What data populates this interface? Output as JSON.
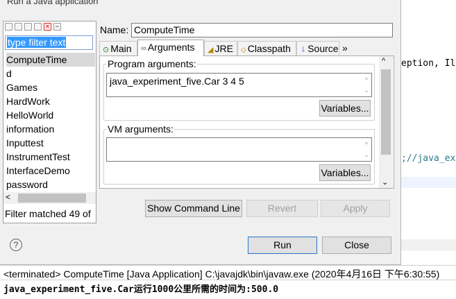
{
  "dialog": {
    "title": "Run a Java application",
    "filter_placeholder": "type filter text",
    "config_list": [
      "ComputeTime",
      "d",
      "Games",
      "HardWork",
      "HelloWorld",
      "information",
      "Inputtest",
      "InstrumentTest",
      "InterfaceDemo",
      "password"
    ],
    "filter_status": "Filter matched 49 of",
    "name_label": "Name:",
    "name_value": "ComputeTime",
    "tabs": [
      {
        "label": "Main",
        "icon": "main-icon"
      },
      {
        "label": "Arguments",
        "icon": "arguments-icon"
      },
      {
        "label": "JRE",
        "icon": "jre-icon"
      },
      {
        "label": "Classpath",
        "icon": "classpath-icon"
      },
      {
        "label": "Source",
        "icon": "source-icon"
      },
      {
        "label": "»",
        "icon": "overflow-icon"
      }
    ],
    "program_args_label": "Program arguments:",
    "program_args_value": "java_experiment_five.Car 3 4 5",
    "vm_args_label": "VM arguments:",
    "vm_args_value": "",
    "variables_label": "Variables...",
    "show_command_line": "Show Command Line",
    "revert": "Revert",
    "apply": "Apply",
    "run": "Run",
    "close": "Close",
    "help": "?"
  },
  "editor": {
    "line1": "eption, Il",
    "line2": ";//java_ex"
  },
  "console": {
    "title": "<terminated> ComputeTime [Java Application] C:\\javajdk\\bin\\javaw.exe (2020年4月16日 下午6:30:55)",
    "output": "java_experiment_five.Car运行1000公里所需的时间为:500.0"
  },
  "colors": {
    "dialog_bg": "#f0f0f0",
    "selection_blue": "#3399ff",
    "code_teal": "#2a7b8c"
  }
}
